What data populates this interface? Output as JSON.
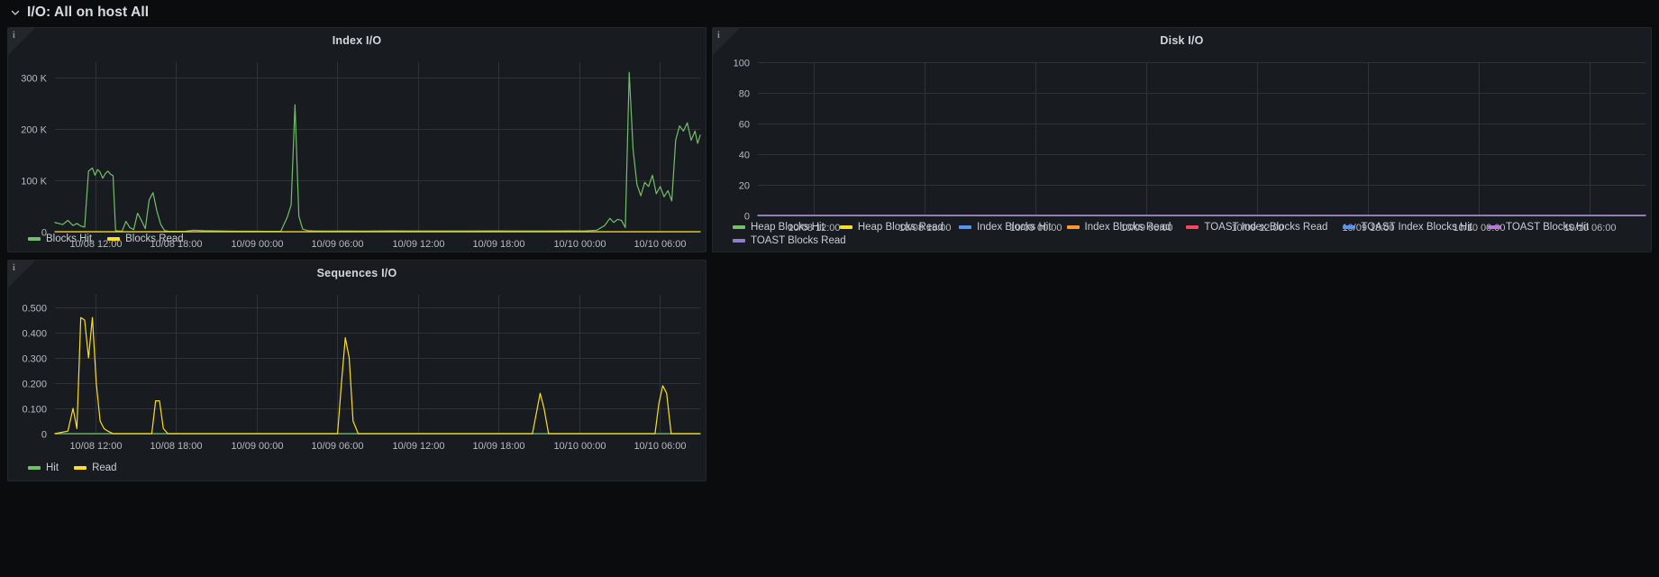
{
  "row": {
    "title": "I/O: All on host All",
    "collapse_icon": "chevron-down-icon",
    "expanded": true
  },
  "panels": [
    {
      "id": "index-io",
      "title": "Index I/O",
      "info_icon": "info-icon",
      "legend": [
        {
          "label": "Blocks Hit",
          "color": "#73bf69"
        },
        {
          "label": "Blocks Read",
          "color": "#fade2a"
        }
      ]
    },
    {
      "id": "disk-io",
      "title": "Disk I/O",
      "info_icon": "info-icon",
      "legend": [
        {
          "label": "Heap Blocks Hit",
          "color": "#73bf69"
        },
        {
          "label": "Heap Blocks Read",
          "color": "#fade2a"
        },
        {
          "label": "Index Blocks Hit",
          "color": "#5794f2"
        },
        {
          "label": "Index Blocks Read",
          "color": "#ff9830"
        },
        {
          "label": "TOAST Index Blocks Read",
          "color": "#f2495c"
        },
        {
          "label": "TOAST Index Blocks Hit",
          "color": "#5794f2"
        },
        {
          "label": "TOAST Blocks Hit",
          "color": "#b877d9"
        },
        {
          "label": "TOAST Blocks Read",
          "color": "#8f7ec9"
        }
      ]
    },
    {
      "id": "sequences-io",
      "title": "Sequences I/O",
      "info_icon": "info-icon",
      "legend": [
        {
          "label": "Hit",
          "color": "#73bf69"
        },
        {
          "label": "Read",
          "color": "#fade2a"
        }
      ]
    }
  ],
  "chart_data": [
    {
      "id": "index-io",
      "type": "line",
      "title": "Index I/O",
      "xlabel": "",
      "ylabel": "",
      "grid": true,
      "legend_position": "bottom",
      "ylim": [
        0,
        330000
      ],
      "yticks": [
        0,
        100000,
        200000,
        300000
      ],
      "ytick_labels": [
        "0",
        "100 K",
        "200 K",
        "300 K"
      ],
      "xticks": [
        "10/08 12:00",
        "10/08 18:00",
        "10/09 00:00",
        "10/09 06:00",
        "10/09 12:00",
        "10/09 18:00",
        "10/10 00:00",
        "10/10 06:00"
      ],
      "x_range": [
        "10/08 09:40",
        "10/10 08:10"
      ],
      "series": [
        {
          "name": "Blocks Hit",
          "color": "#73bf69",
          "x": [
            0.0,
            0.012,
            0.02,
            0.028,
            0.034,
            0.04,
            0.046,
            0.052,
            0.058,
            0.062,
            0.066,
            0.07,
            0.074,
            0.078,
            0.082,
            0.086,
            0.09,
            0.094,
            0.098,
            0.104,
            0.11,
            0.116,
            0.122,
            0.128,
            0.134,
            0.14,
            0.146,
            0.152,
            0.158,
            0.164,
            0.17,
            0.176,
            0.182,
            0.19,
            0.2,
            0.215,
            0.23,
            0.25,
            0.27,
            0.29,
            0.31,
            0.33,
            0.35,
            0.36,
            0.366,
            0.372,
            0.378,
            0.384,
            0.392,
            0.4,
            0.42,
            0.45,
            0.48,
            0.52,
            0.56,
            0.6,
            0.64,
            0.68,
            0.72,
            0.76,
            0.8,
            0.82,
            0.84,
            0.852,
            0.86,
            0.866,
            0.872,
            0.878,
            0.884,
            0.89,
            0.896,
            0.902,
            0.908,
            0.914,
            0.92,
            0.926,
            0.932,
            0.938,
            0.944,
            0.95,
            0.956,
            0.962,
            0.968,
            0.974,
            0.98,
            0.986,
            0.992,
            0.996,
            1.0
          ],
          "y": [
            18000,
            14000,
            22000,
            12000,
            16000,
            11000,
            9000,
            118000,
            124000,
            110000,
            121000,
            116000,
            104000,
            113000,
            118000,
            112000,
            109000,
            2000,
            1500,
            1000,
            20000,
            8000,
            4000,
            36000,
            22000,
            6000,
            62000,
            76000,
            40000,
            14000,
            2000,
            1000,
            800,
            700,
            600,
            3000,
            2000,
            1500,
            1200,
            1000,
            900,
            800,
            900,
            28000,
            52000,
            247000,
            30000,
            5000,
            2000,
            1500,
            1200,
            1400,
            1200,
            1500,
            1300,
            1400,
            1300,
            1500,
            1400,
            1300,
            1500,
            1400,
            3000,
            12000,
            26000,
            18000,
            24000,
            22000,
            8000,
            310000,
            160000,
            92000,
            70000,
            96000,
            88000,
            110000,
            74000,
            88000,
            68000,
            80000,
            60000,
            178000,
            206000,
            196000,
            212000,
            178000,
            196000,
            172000,
            188000,
            100000,
            86000,
            142000
          ]
        },
        {
          "name": "Blocks Read",
          "color": "#fade2a",
          "x": [
            0.0,
            0.1,
            0.2,
            0.3,
            0.4,
            0.5,
            0.6,
            0.7,
            0.8,
            0.9,
            1.0
          ],
          "y": [
            0,
            0,
            0,
            0,
            0,
            0,
            0,
            0,
            0,
            0,
            0
          ]
        }
      ]
    },
    {
      "id": "disk-io",
      "type": "line",
      "title": "Disk I/O",
      "xlabel": "",
      "ylabel": "",
      "grid": true,
      "legend_position": "bottom",
      "ylim": [
        0,
        100
      ],
      "yticks": [
        0,
        20,
        40,
        60,
        80,
        100
      ],
      "ytick_labels": [
        "0",
        "20",
        "40",
        "60",
        "80",
        "100"
      ],
      "xticks": [
        "10/08 12:00",
        "10/08 18:00",
        "10/09 00:00",
        "10/09 06:00",
        "10/09 12:00",
        "10/09 18:00",
        "10/10 00:00",
        "10/10 06:00"
      ],
      "x_range": [
        "10/08 09:40",
        "10/10 08:10"
      ],
      "series": [
        {
          "name": "Heap Blocks Hit",
          "color": "#73bf69",
          "x": [
            0,
            1
          ],
          "y": [
            0,
            0
          ]
        },
        {
          "name": "Heap Blocks Read",
          "color": "#fade2a",
          "x": [
            0,
            1
          ],
          "y": [
            0,
            0
          ]
        },
        {
          "name": "Index Blocks Hit",
          "color": "#5794f2",
          "x": [
            0,
            1
          ],
          "y": [
            0,
            0
          ]
        },
        {
          "name": "Index Blocks Read",
          "color": "#ff9830",
          "x": [
            0,
            1
          ],
          "y": [
            0,
            0
          ]
        },
        {
          "name": "TOAST Index Blocks Read",
          "color": "#f2495c",
          "x": [
            0,
            1
          ],
          "y": [
            0,
            0
          ]
        },
        {
          "name": "TOAST Index Blocks Hit",
          "color": "#5794f2",
          "x": [
            0,
            1
          ],
          "y": [
            0,
            0
          ]
        },
        {
          "name": "TOAST Blocks Hit",
          "color": "#b877d9",
          "x": [
            0,
            1
          ],
          "y": [
            0,
            0
          ]
        },
        {
          "name": "TOAST Blocks Read",
          "color": "#8f7ec9",
          "x": [
            0,
            1
          ],
          "y": [
            0,
            0
          ]
        }
      ]
    },
    {
      "id": "sequences-io",
      "type": "line",
      "title": "Sequences I/O",
      "xlabel": "",
      "ylabel": "",
      "grid": true,
      "legend_position": "bottom",
      "ylim": [
        0,
        0.55
      ],
      "yticks": [
        0,
        0.1,
        0.2,
        0.3,
        0.4,
        0.5
      ],
      "ytick_labels": [
        "0",
        "0.100",
        "0.200",
        "0.300",
        "0.400",
        "0.500"
      ],
      "xticks": [
        "10/08 12:00",
        "10/08 18:00",
        "10/09 00:00",
        "10/09 06:00",
        "10/09 12:00",
        "10/09 18:00",
        "10/10 00:00",
        "10/10 06:00"
      ],
      "x_range": [
        "10/08 09:40",
        "10/10 08:10"
      ],
      "series": [
        {
          "name": "Hit",
          "color": "#73bf69",
          "x": [
            0,
            1
          ],
          "y": [
            0,
            0
          ]
        },
        {
          "name": "Read",
          "color": "#fade2a",
          "x": [
            0.0,
            0.02,
            0.028,
            0.034,
            0.04,
            0.046,
            0.052,
            0.058,
            0.064,
            0.07,
            0.076,
            0.082,
            0.09,
            0.1,
            0.12,
            0.14,
            0.15,
            0.156,
            0.162,
            0.168,
            0.175,
            0.2,
            0.25,
            0.3,
            0.35,
            0.4,
            0.438,
            0.444,
            0.45,
            0.456,
            0.462,
            0.47,
            0.5,
            0.55,
            0.6,
            0.65,
            0.7,
            0.74,
            0.746,
            0.752,
            0.758,
            0.765,
            0.8,
            0.85,
            0.9,
            0.93,
            0.936,
            0.942,
            0.948,
            0.955,
            0.975,
            1.0
          ],
          "y": [
            0,
            0.01,
            0.1,
            0.02,
            0.46,
            0.45,
            0.3,
            0.46,
            0.2,
            0.05,
            0.02,
            0.01,
            0,
            0,
            0,
            0,
            0,
            0.13,
            0.13,
            0.02,
            0,
            0,
            0,
            0,
            0,
            0,
            0,
            0.2,
            0.38,
            0.3,
            0.05,
            0,
            0,
            0,
            0,
            0,
            0,
            0,
            0.08,
            0.16,
            0.1,
            0,
            0,
            0,
            0,
            0,
            0.12,
            0.19,
            0.16,
            0,
            0,
            0
          ]
        }
      ]
    }
  ]
}
